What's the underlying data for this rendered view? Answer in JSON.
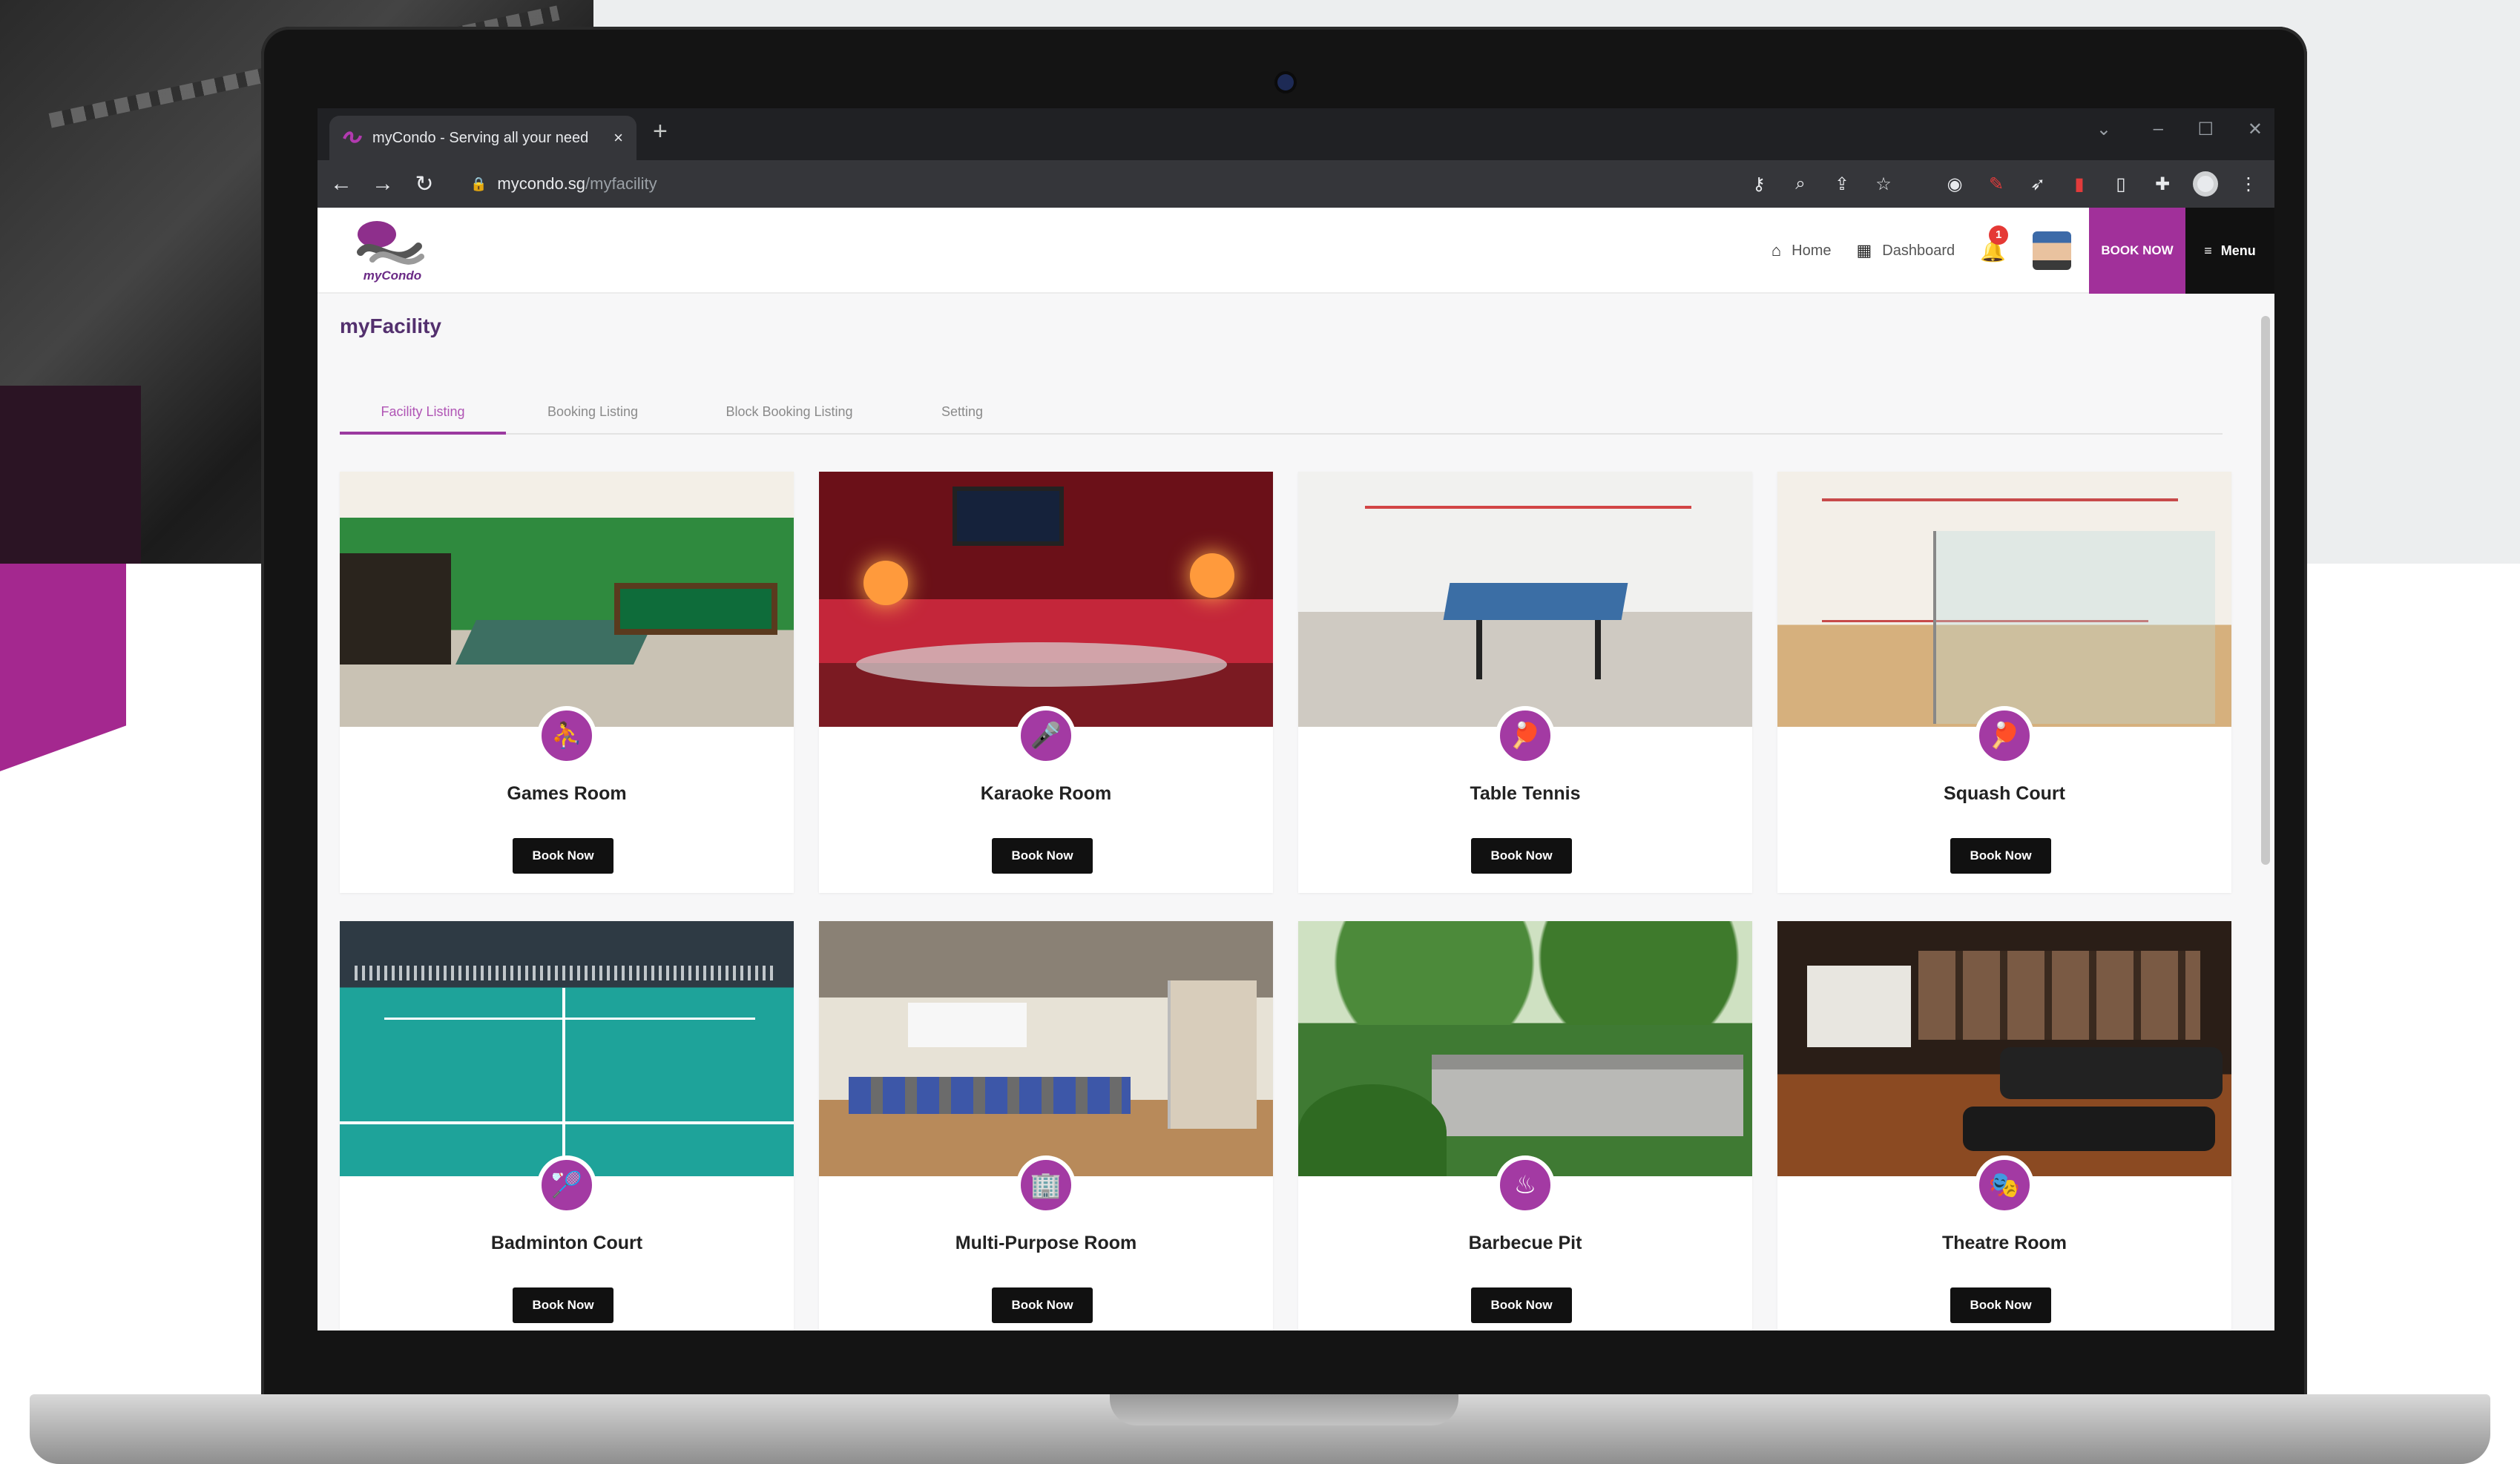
{
  "browser": {
    "tab_title": "myCondo - Serving all your need",
    "tab_close": "×",
    "new_tab": "+",
    "url_host": "mycondo.sg",
    "url_path": "/myfacility"
  },
  "header": {
    "logo_text": "myCondo",
    "nav": [
      {
        "label": "Home",
        "icon": "home-icon"
      },
      {
        "label": "Dashboard",
        "icon": "dashboard-icon"
      }
    ],
    "notification_count": "1",
    "book_now_label": "BOOK NOW",
    "menu_label": "Menu"
  },
  "page": {
    "title": "myFacility",
    "tabs": [
      {
        "label": "Facility Listing",
        "active": true
      },
      {
        "label": "Booking Listing",
        "active": false
      },
      {
        "label": "Block Booking Listing",
        "active": false
      },
      {
        "label": "Setting",
        "active": false
      }
    ]
  },
  "facilities": [
    {
      "name": "Games Room",
      "icon": "games-icon",
      "button": "Book Now"
    },
    {
      "name": "Karaoke Room",
      "icon": "microphone-icon",
      "button": "Book Now"
    },
    {
      "name": "Table Tennis",
      "icon": "racket-icon",
      "button": "Book Now"
    },
    {
      "name": "Squash Court",
      "icon": "racket-icon",
      "button": "Book Now"
    },
    {
      "name": "Badminton Court",
      "icon": "racket-icon",
      "button": "Book Now"
    },
    {
      "name": "Multi-Purpose Room",
      "icon": "building-icon",
      "button": "Book Now"
    },
    {
      "name": "Barbecue Pit",
      "icon": "grill-icon",
      "button": "Book Now"
    },
    {
      "name": "Theatre Room",
      "icon": "theatre-icon",
      "button": "Book Now"
    }
  ],
  "colors": {
    "brand_purple": "#a1309a",
    "title_purple": "#53306e",
    "button_black": "#111111"
  }
}
